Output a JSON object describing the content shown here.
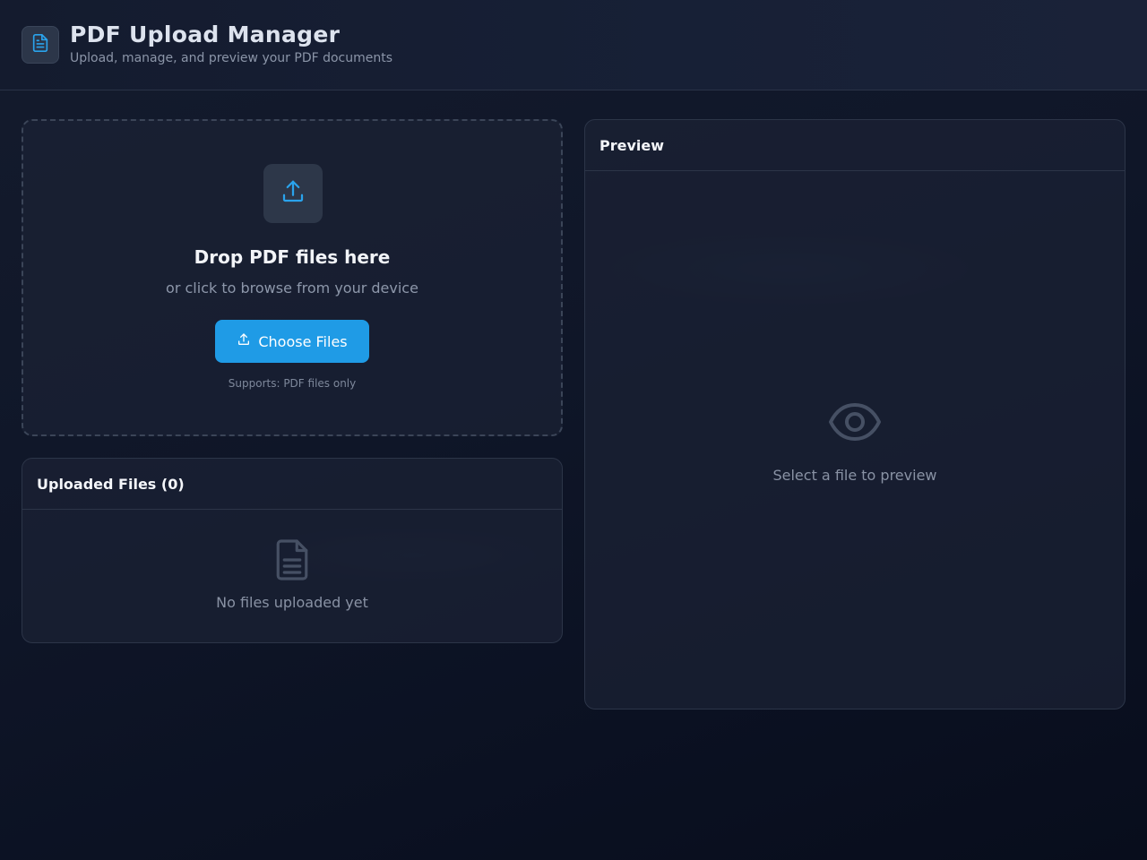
{
  "header": {
    "title": "PDF Upload Manager",
    "subtitle": "Upload, manage, and preview your PDF documents"
  },
  "dropzone": {
    "title": "Drop PDF files here",
    "subtitle": "or click to browse from your device",
    "button_label": "Choose Files",
    "supports": "Supports: PDF files only"
  },
  "files_panel": {
    "title": "Uploaded Files (0)",
    "empty_text": "No files uploaded yet"
  },
  "preview_panel": {
    "title": "Preview",
    "empty_text": "Select a file to preview"
  },
  "icons": {
    "logo": "document-icon",
    "upload": "upload-icon",
    "button": "upload-icon",
    "empty_files": "file-text-icon",
    "empty_preview": "eye-icon"
  },
  "colors": {
    "accent": "#1f9be6",
    "background": "#0f1628",
    "panel": "#1b2234",
    "border": "#2c3548",
    "muted_text": "#8b95a8"
  }
}
